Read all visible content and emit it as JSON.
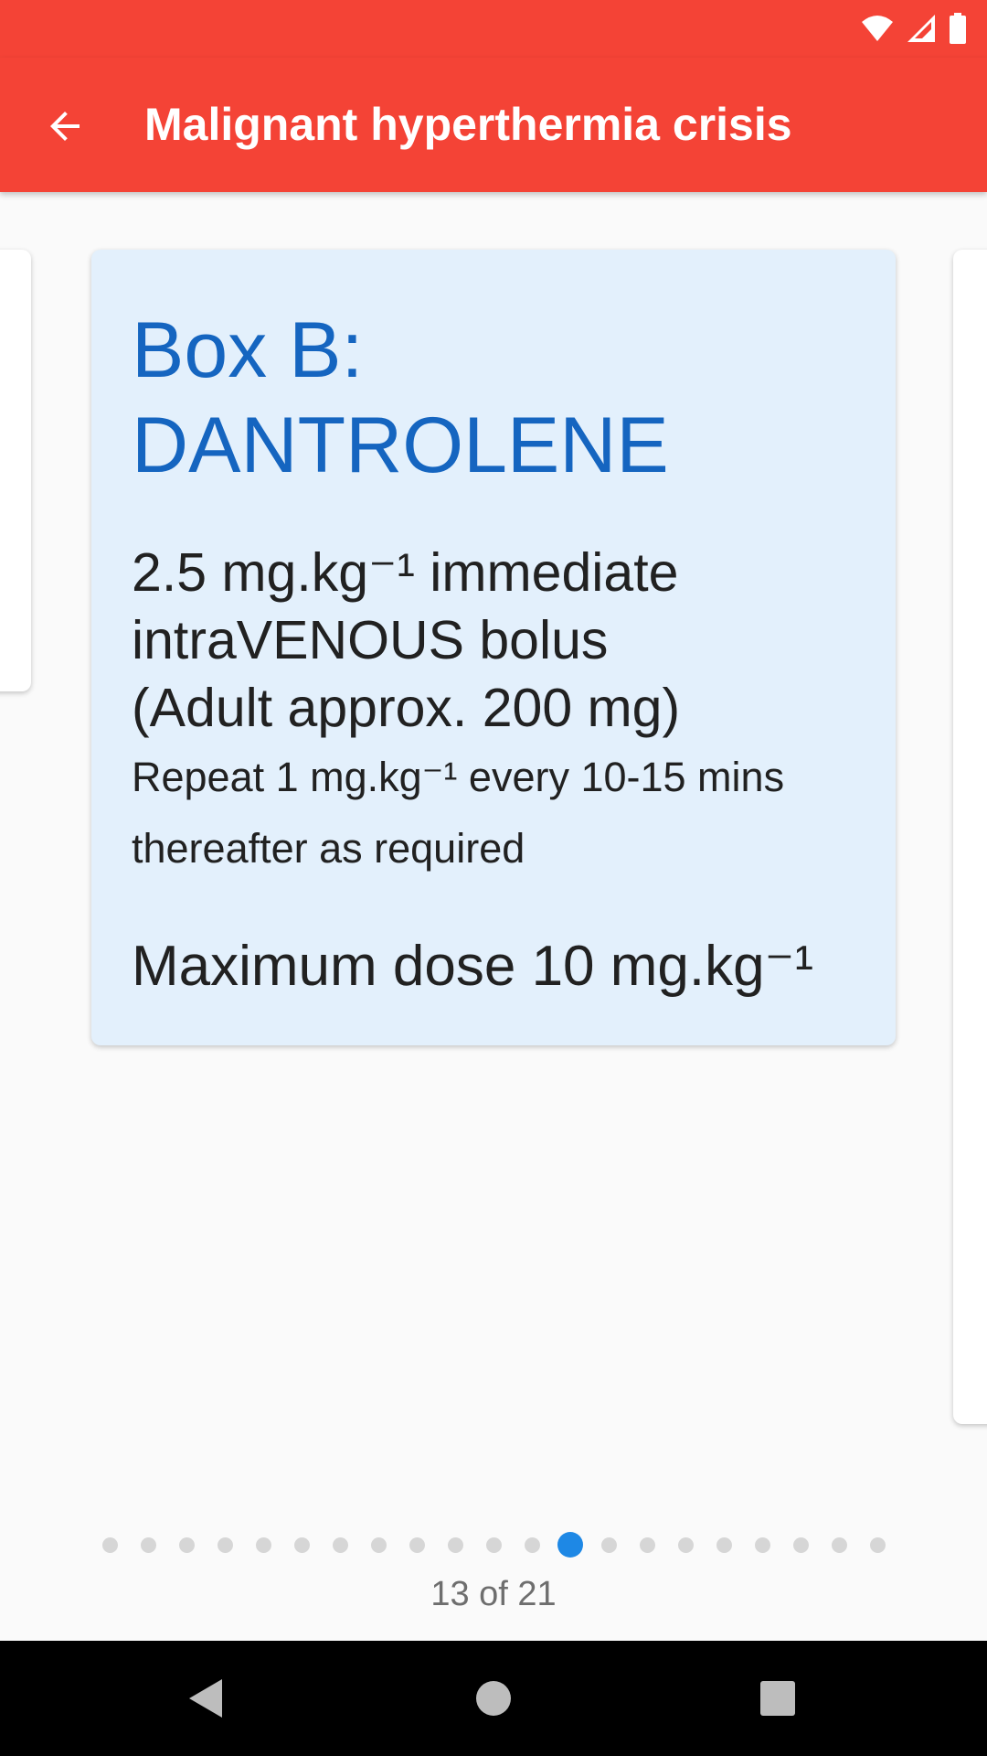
{
  "status_bar": {
    "icons": [
      "wifi-icon",
      "cellular-signal-icon",
      "battery-icon"
    ]
  },
  "app_bar": {
    "title": "Malignant hyperthermia crisis",
    "back_icon": "arrow-back-icon",
    "background_color": "#f44336"
  },
  "card": {
    "title_line1": "Box B:",
    "title_line2": "DANTROLENE",
    "dose_line1": "2.5 mg.kg⁻¹ immediate",
    "dose_line2": "intraVENOUS bolus",
    "dose_line3": "(Adult approx. 200 mg)",
    "repeat_line1": "Repeat 1 mg.kg⁻¹ every 10-15 mins",
    "repeat_line2": "thereafter as required",
    "max_dose": "Maximum dose 10 mg.kg⁻¹",
    "background_color": "#e3f0fc",
    "title_color": "#1565c0"
  },
  "pager": {
    "current": 13,
    "total": 21,
    "counter_text": "13 of 21",
    "active_color": "#1e88e5"
  },
  "nav_bar": {
    "icons": [
      "back-triangle-icon",
      "home-circle-icon",
      "recents-square-icon"
    ]
  }
}
